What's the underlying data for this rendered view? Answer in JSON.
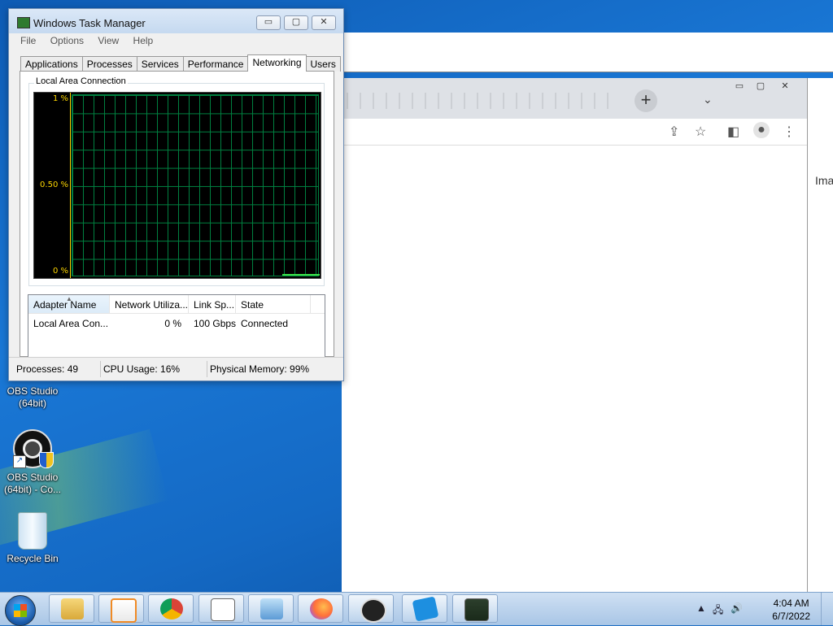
{
  "desktop": {
    "icons": [
      {
        "label": "OBS Studio\n(64bit)"
      },
      {
        "label": "OBS Studio\n(64bit) - Co..."
      },
      {
        "label": "Recycle Bin"
      }
    ],
    "partial_text_right": "Ima"
  },
  "task_manager": {
    "title": "Windows Task Manager",
    "controls": {
      "minimize": "▭",
      "maximize": "▢",
      "close": "✕"
    },
    "menu": [
      "File",
      "Options",
      "View",
      "Help"
    ],
    "tabs": [
      "Applications",
      "Processes",
      "Services",
      "Performance",
      "Networking",
      "Users"
    ],
    "active_tab": "Networking",
    "group_label": "Local Area Connection",
    "graph": {
      "y_labels": [
        "1 %",
        "0.50 %",
        "0 %"
      ],
      "line_color": "#ffd800",
      "grid_color": "#008040",
      "trace_color": "#3ce34a"
    },
    "columns": [
      "Adapter Name",
      "Network Utiliza...",
      "Link Sp...",
      "State"
    ],
    "rows": [
      {
        "adapter": "Local Area Con...",
        "utilization": "0 %",
        "link_speed": "100 Gbps",
        "state": "Connected"
      }
    ],
    "status": {
      "processes": "Processes: 49",
      "cpu": "CPU Usage: 16%",
      "memory": "Physical Memory: 99%"
    }
  },
  "browser": {
    "new_tab": "+",
    "tab_menu": "⌄",
    "window_controls": {
      "minimize": "▭",
      "maximize": "▢",
      "close": "✕"
    },
    "toolbar_icons": [
      "share-icon",
      "star-icon",
      "sidepanel-icon",
      "profile-icon",
      "menu-icon"
    ]
  },
  "taskbar": {
    "apps": [
      "explorer",
      "media-player",
      "chrome",
      "solitaire",
      "control-panel",
      "firefox",
      "obs",
      "roblox",
      "task-manager"
    ],
    "clock": {
      "time": "4:04 AM",
      "date": "6/7/2022"
    }
  }
}
